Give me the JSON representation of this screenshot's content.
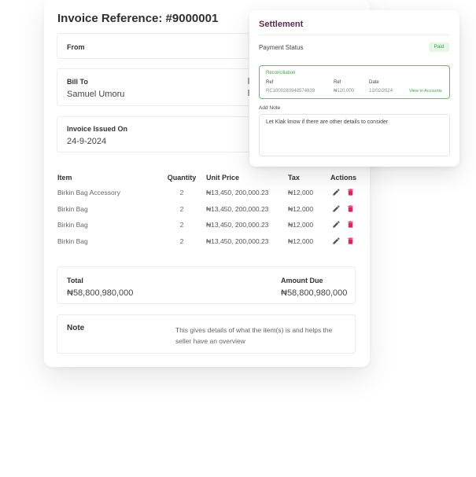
{
  "invoice": {
    "title": "Invoice Reference: #9000001",
    "from_label": "From",
    "bill_to_label": "Bill To",
    "bill_to_value": "Samuel Umoru",
    "issued_label": "Invoice Issued On",
    "issued_value": "24-9-2024",
    "items": {
      "headers": {
        "item": "Item",
        "quantity": "Quantity",
        "unit_price": "Unit Price",
        "tax": "Tax",
        "actions": "Actions"
      },
      "rows": [
        {
          "item": "Birkin Bag Accessory",
          "quantity": "2",
          "unit_price": "₦13,450, 200,000.23",
          "tax": "₦12,000"
        },
        {
          "item": "Birkin Bag",
          "quantity": "2",
          "unit_price": "₦13,450, 200,000.23",
          "tax": "₦12,000"
        },
        {
          "item": "Birkin Bag",
          "quantity": "2",
          "unit_price": "₦13,450, 200,000.23",
          "tax": "₦12,000"
        },
        {
          "item": "Birkin Bag",
          "quantity": "2",
          "unit_price": "₦13,450, 200,000.23",
          "tax": "₦12,000"
        }
      ],
      "action_icons": [
        "edit-icon",
        "trash-icon"
      ]
    },
    "total_label": "Total",
    "total_value": "₦58,800,980,000",
    "amount_due_label": "Amount Due",
    "amount_due_value": "₦58,800,980,000",
    "note_label": "Note",
    "note_text": "This gives details of what the item(s) is and helps the seller have an overview"
  },
  "settlement": {
    "title": "Settlement",
    "payment_status_label": "Payment Status",
    "payment_status_badge": "Paid",
    "reconciliation": {
      "title": "Reconciliation",
      "ref_label": "Ref",
      "ref_value": "RC1000283948574839",
      "amount_label": "Ref",
      "amount_value": "₦120,000",
      "date_label": "Date",
      "date_value": "12/02/2024",
      "link_label": "View In Accounts"
    },
    "add_note_label": "Add Note",
    "add_note_value": "Let Klak know if there are other details to consider"
  },
  "colors": {
    "title_purple": "#5a2d4f",
    "paid_green": "#43a047",
    "trash_pink": "#e91e63",
    "edit_gray": "#555555"
  }
}
